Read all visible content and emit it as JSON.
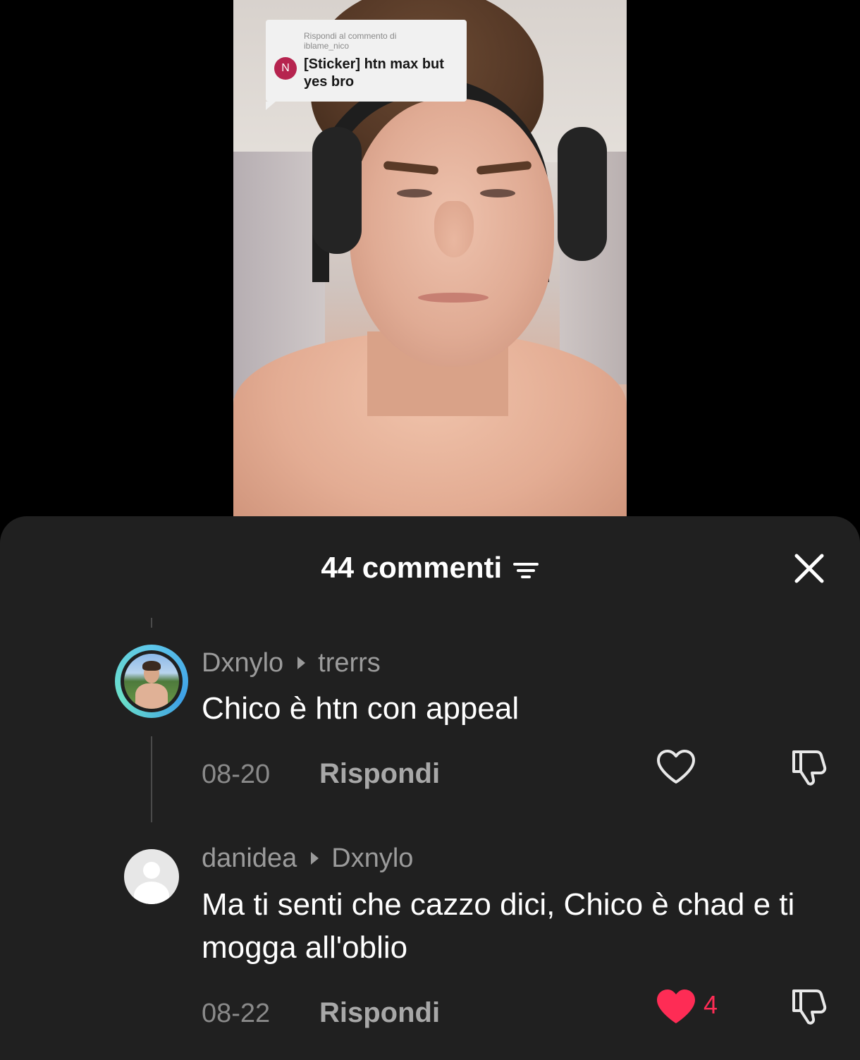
{
  "sticker": {
    "caption": "Rispondi al commento di\niblame_nico",
    "avatar_letter": "N",
    "text": "[Sticker] htn max but yes bro"
  },
  "panel": {
    "title": "44 commenti"
  },
  "comments": [
    {
      "author": "Dxnylo",
      "reply_to": "trerrs",
      "text": "Chico è htn con appeal",
      "date": "08-20",
      "reply_label": "Rispondi",
      "liked": false,
      "likes": ""
    },
    {
      "author": "danidea",
      "reply_to": "Dxnylo",
      "text": "Ma ti senti che cazzo dici, Chico è chad e ti mogga all'oblio",
      "date": "08-22",
      "reply_label": "Rispondi",
      "liked": true,
      "likes": "4"
    }
  ],
  "icons": {
    "filter": "filter-icon",
    "close": "close-icon",
    "like": "heart-icon",
    "dislike": "thumbs-down-icon"
  },
  "colors": {
    "panel_bg": "#202020",
    "like_active": "#fe2c55",
    "sticker_avatar": "#b6244f"
  }
}
